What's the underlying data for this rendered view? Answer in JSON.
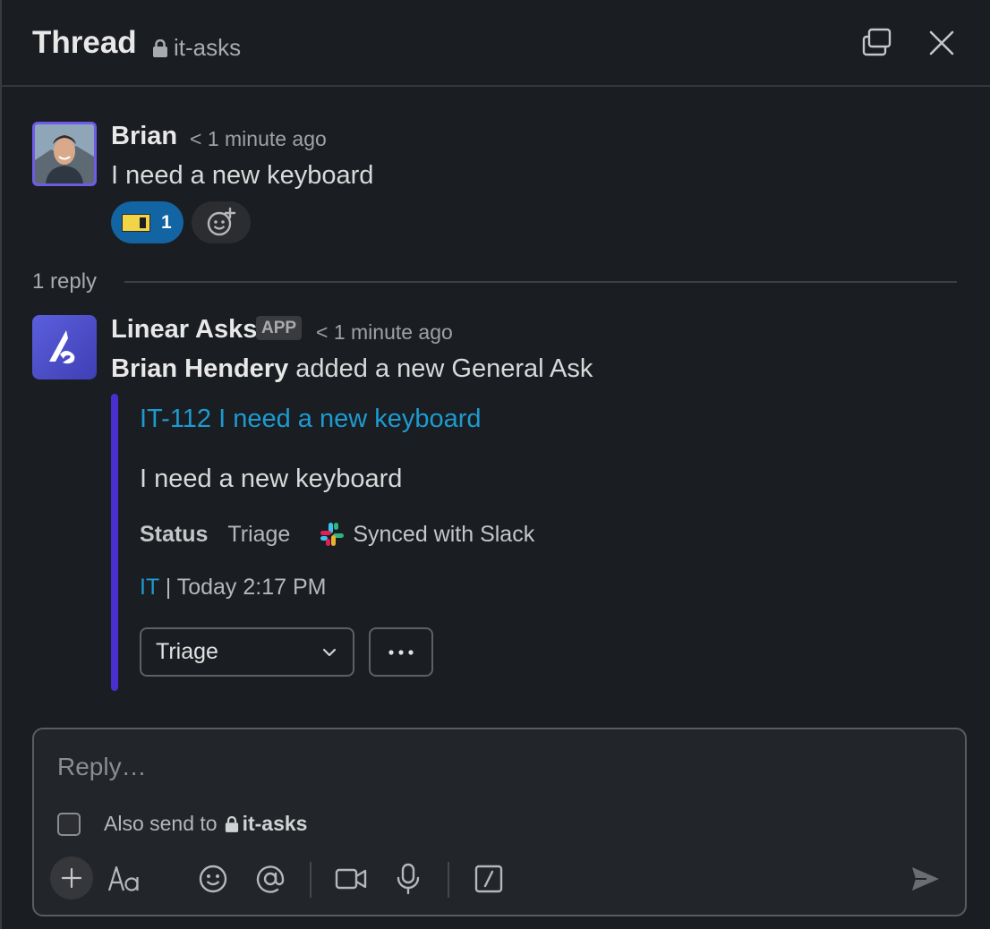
{
  "header": {
    "title": "Thread",
    "channel": "it-asks"
  },
  "message1": {
    "author": "Brian",
    "time": "< 1 minute ago",
    "text": "I need a new keyboard",
    "reaction": {
      "emoji": "ticket",
      "count": "1"
    }
  },
  "replies": {
    "label": "1 reply"
  },
  "message2": {
    "author": "Linear Asks",
    "badge": "APP",
    "time": "< 1 minute ago",
    "actor": "Brian Hendery",
    "action": " added a new General Ask",
    "attachment": {
      "issue_link": "IT-112 I need a new keyboard",
      "description": "I need a new keyboard",
      "status_label": "Status",
      "status_value": "Triage",
      "sync_text": "Synced with Slack",
      "team_link": "IT",
      "meta_rest": " | Today 2:17 PM",
      "select_value": "Triage",
      "accent_color": "#4a2fd0"
    }
  },
  "composer": {
    "placeholder": "Reply…",
    "also_send_label": "Also send to",
    "also_send_channel": "it-asks"
  },
  "colors": {
    "background": "#1a1d21",
    "link": "#1d9bd1",
    "reaction_bg": "#1264a3"
  }
}
